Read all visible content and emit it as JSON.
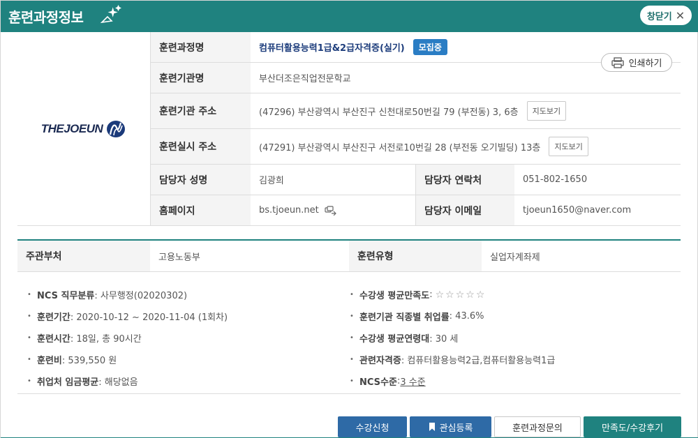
{
  "header": {
    "title": "훈련과정정보",
    "close_label": "창닫기",
    "close_x": "✕"
  },
  "print_label": "인쇄하기",
  "logo_text": "THEJOEUN",
  "info": {
    "course_name_label": "훈련과정명",
    "course_name": "컴퓨터활용능력1급&2급자격증(실기)",
    "status_badge": "모집중",
    "institution_label": "훈련기관명",
    "institution": "부산더조은직업전문학교",
    "inst_address_label": "훈련기관 주소",
    "inst_address": "(47296) 부산광역시 부산진구 신천대로50번길 79 (부전동) 3, 6층",
    "training_address_label": "훈련실시 주소",
    "training_address": "(47291) 부산광역시 부산진구 서전로10번길 28 (부전동 오기빌딩) 13층",
    "map_label": "지도보기",
    "manager_name_label": "담당자 성명",
    "manager_name": "김광희",
    "manager_phone_label": "담당자 연락처",
    "manager_phone": "051-802-1650",
    "homepage_label": "홈페이지",
    "homepage": "bs.tjoeun.net",
    "manager_email_label": "담당자 이메일",
    "manager_email": "tjoeun1650@naver.com"
  },
  "summary": {
    "dept_label": "주관부처",
    "dept": "고용노동부",
    "type_label": "훈련유형",
    "type": "실업자계좌제"
  },
  "details_left": [
    {
      "label": "NCS 직무분류",
      "value": " : 사무행정(02020302)"
    },
    {
      "label": "훈련기간",
      "value": " : 2020-10-12 ~ 2020-11-04 (1회차)"
    },
    {
      "label": "훈련시간",
      "value": " : 18일, 총 90시간"
    },
    {
      "label": "훈련비",
      "value": " : 539,550 원"
    },
    {
      "label": "취업처 임금평균",
      "value": " : 해당없음"
    }
  ],
  "details_right": [
    {
      "label": "수강생 평균만족도",
      "value": " : "
    },
    {
      "label": "훈련기관 직종별 취업률",
      "value": " : 43.6%"
    },
    {
      "label": "수강생 평균연령대",
      "value": " : 30 세"
    },
    {
      "label": "관련자격증",
      "value": " : 컴퓨터활용능력2급,컴퓨터활용능력1급"
    },
    {
      "label": "NCS수준",
      "value": " : "
    }
  ],
  "satisfaction_stars": "☆☆☆☆☆",
  "ncs_level": "3 수준",
  "buttons": {
    "apply": "수강신청",
    "bookmark": "관심등록",
    "inquiry": "훈련과정문의",
    "review": "만족도/수강후기"
  },
  "colors": {
    "primary": "#1f827f",
    "button_blue": "#2e6aa6",
    "badge_blue": "#2a7dc4"
  }
}
